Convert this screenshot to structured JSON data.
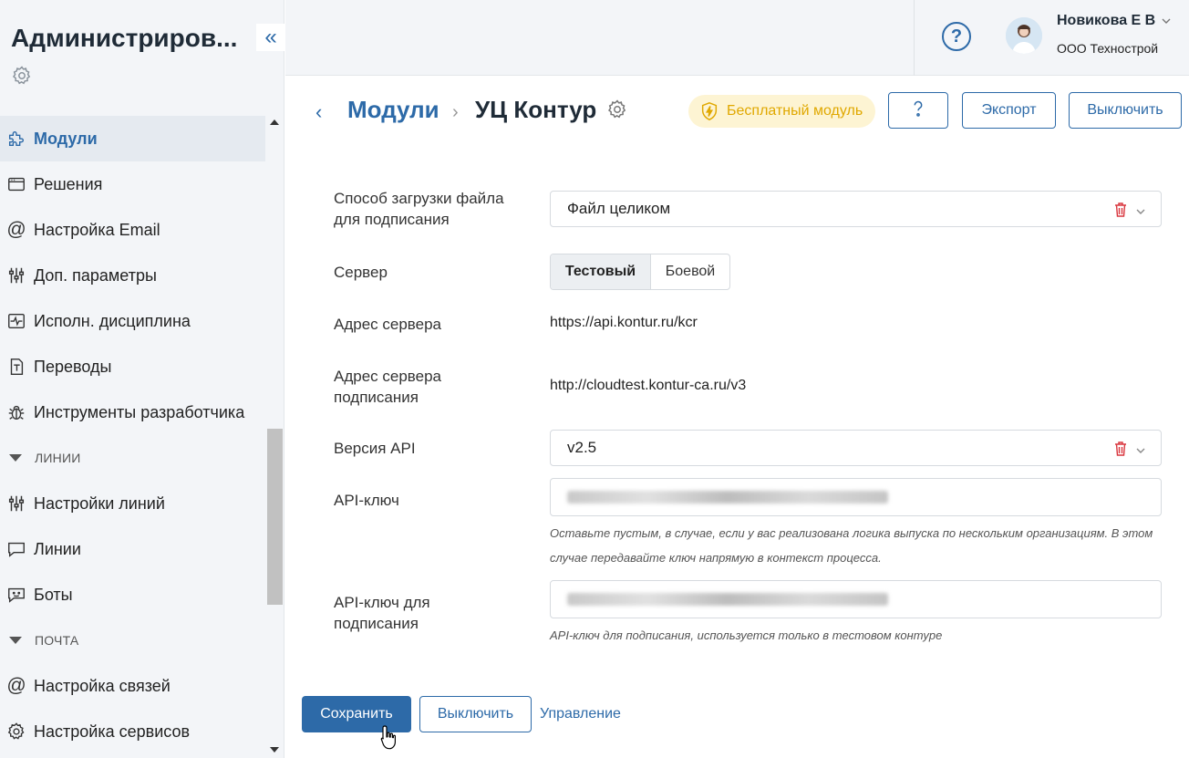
{
  "sidebar": {
    "title": "Администриров...",
    "items": [
      {
        "label": "Модули",
        "icon": "puzzle-icon",
        "active": true
      },
      {
        "label": "Решения",
        "icon": "window-icon"
      },
      {
        "label": "Настройка Email",
        "icon": "at-icon"
      },
      {
        "label": "Доп. параметры",
        "icon": "sliders-icon"
      },
      {
        "label": "Исполн. дисциплина",
        "icon": "pulse-icon"
      },
      {
        "label": "Переводы",
        "icon": "translate-icon"
      },
      {
        "label": "Инструменты разработчика",
        "icon": "bug-icon"
      }
    ],
    "section_lines": "ЛИНИИ",
    "lines_items": [
      {
        "label": "Настройки линий",
        "icon": "sliders-icon"
      },
      {
        "label": "Линии",
        "icon": "chat-icon"
      },
      {
        "label": "Боты",
        "icon": "bot-icon"
      }
    ],
    "section_mail": "ПОЧТА",
    "mail_items": [
      {
        "label": "Настройка связей",
        "icon": "at-icon"
      },
      {
        "label": "Настройка сервисов",
        "icon": "gear-icon"
      }
    ]
  },
  "header": {
    "help": "?",
    "user_name": "Новикова Е В",
    "user_org": "ООО Технострой"
  },
  "titlebar": {
    "back": "‹",
    "crumb": "Модули",
    "sep": "›",
    "current": "УЦ Контур",
    "badge": "Бесплатный модуль",
    "export": "Экспорт",
    "disable": "Выключить"
  },
  "form": {
    "upload_label": "Способ загрузки файла для подписания",
    "upload_value": "Файл целиком",
    "server_label": "Сервер",
    "server_opt1": "Тестовый",
    "server_opt2": "Боевой",
    "server_addr_label": "Адрес сервера",
    "server_addr_value": "https://api.kontur.ru/kcr",
    "sign_addr_label": "Адрес сервера подписания",
    "sign_addr_value": "http://cloudtest.kontur-ca.ru/v3",
    "api_ver_label": "Версия API",
    "api_ver_value": "v2.5",
    "api_key_label": "API-ключ",
    "api_key_hint": "Оставьте пустым, в случае, если у вас реализована логика выпуска по нескольким организациям. В этом случае передавайте ключ напрямую в контекст процесса.",
    "api_sign_label": "API-ключ для подписания",
    "api_sign_hint": "API-ключ для подписания, используется только в тестовом контуре"
  },
  "footer": {
    "save": "Сохранить",
    "disable": "Выключить",
    "manage": "Управление"
  },
  "colors": {
    "accent": "#2d6aa8",
    "badge_bg": "#fdf4d3",
    "badge_fg": "#e0a800",
    "danger": "#d9363e"
  }
}
